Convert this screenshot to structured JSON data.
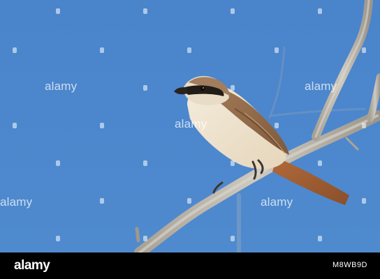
{
  "photo": {
    "description_colors": {
      "sky": "#4b86cc",
      "branch": "#b7b2a6",
      "bird_back": "#a0714a",
      "bird_belly": "#efe4cf",
      "mask": "#1e1a16"
    }
  },
  "watermark": {
    "text": "alamy",
    "icon": "alamy-dot-icon"
  },
  "footer": {
    "brand": "alamy",
    "image_id": "M8WB9D"
  }
}
